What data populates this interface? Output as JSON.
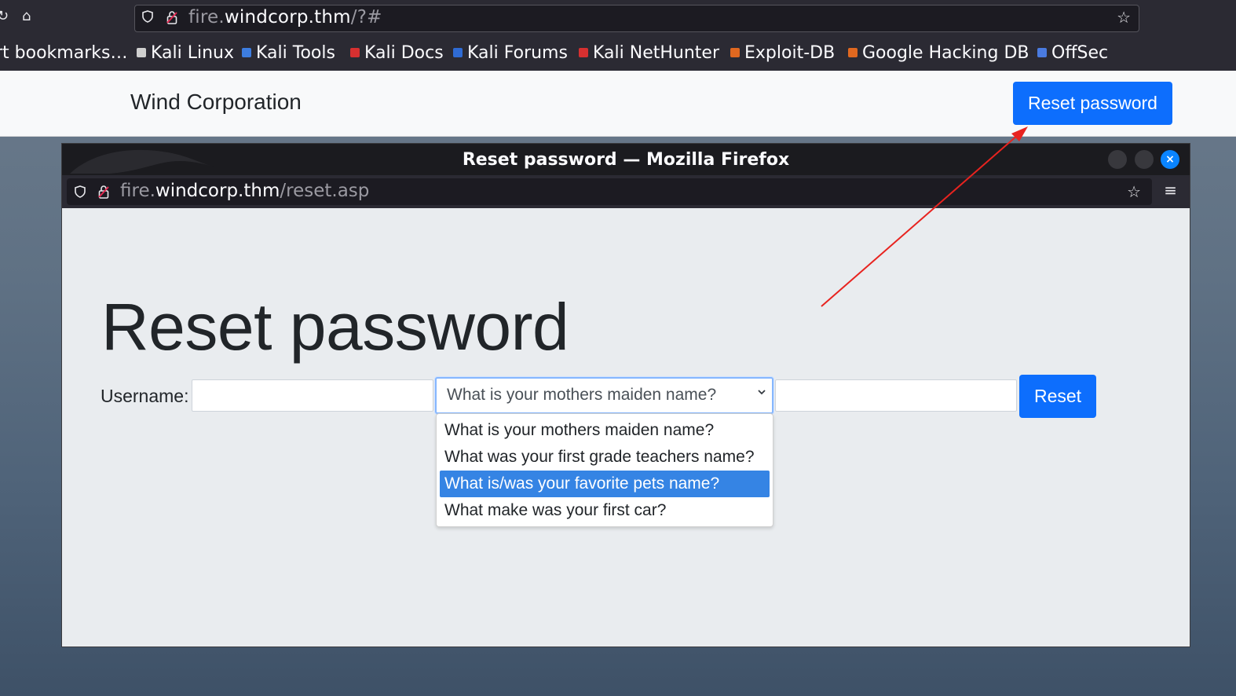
{
  "browser": {
    "url_prefix": "fire.",
    "url_host": "windcorp.thm",
    "url_path": "/?#",
    "bookmarks": [
      {
        "label": "rt bookmarks…",
        "color": ""
      },
      {
        "label": "Kali Linux",
        "color": "#cfcfcf"
      },
      {
        "label": "Kali Tools",
        "color": "#3d7de0"
      },
      {
        "label": "Kali Docs",
        "color": "#d63030"
      },
      {
        "label": "Kali Forums",
        "color": "#2f6bd4"
      },
      {
        "label": "Kali NetHunter",
        "color": "#d63030"
      },
      {
        "label": "Exploit-DB",
        "color": "#e06820"
      },
      {
        "label": "Google Hacking DB",
        "color": "#e06820"
      },
      {
        "label": "OffSec",
        "color": "#4a7be0"
      }
    ]
  },
  "site": {
    "brand": "Wind Corporation",
    "nav_button": "Reset password"
  },
  "popup": {
    "title": "Reset password — Mozilla Firefox",
    "url_prefix": "fire.",
    "url_host": "windcorp.thm",
    "url_path": "/reset.asp",
    "heading": "Reset password",
    "username_label": "Username:",
    "username_value": "",
    "answer_value": "",
    "selected_question": "What is your mothers maiden name?",
    "reset_button": "Reset",
    "questions": [
      "What is your mothers maiden name?",
      "What was your first grade teachers name?",
      "What is/was your favorite pets name?",
      "What make was your first car?"
    ],
    "highlighted_index": 2
  },
  "colors": {
    "accent": "#0d6efd",
    "highlight": "#3584e4",
    "annotation": "#e8231f"
  }
}
